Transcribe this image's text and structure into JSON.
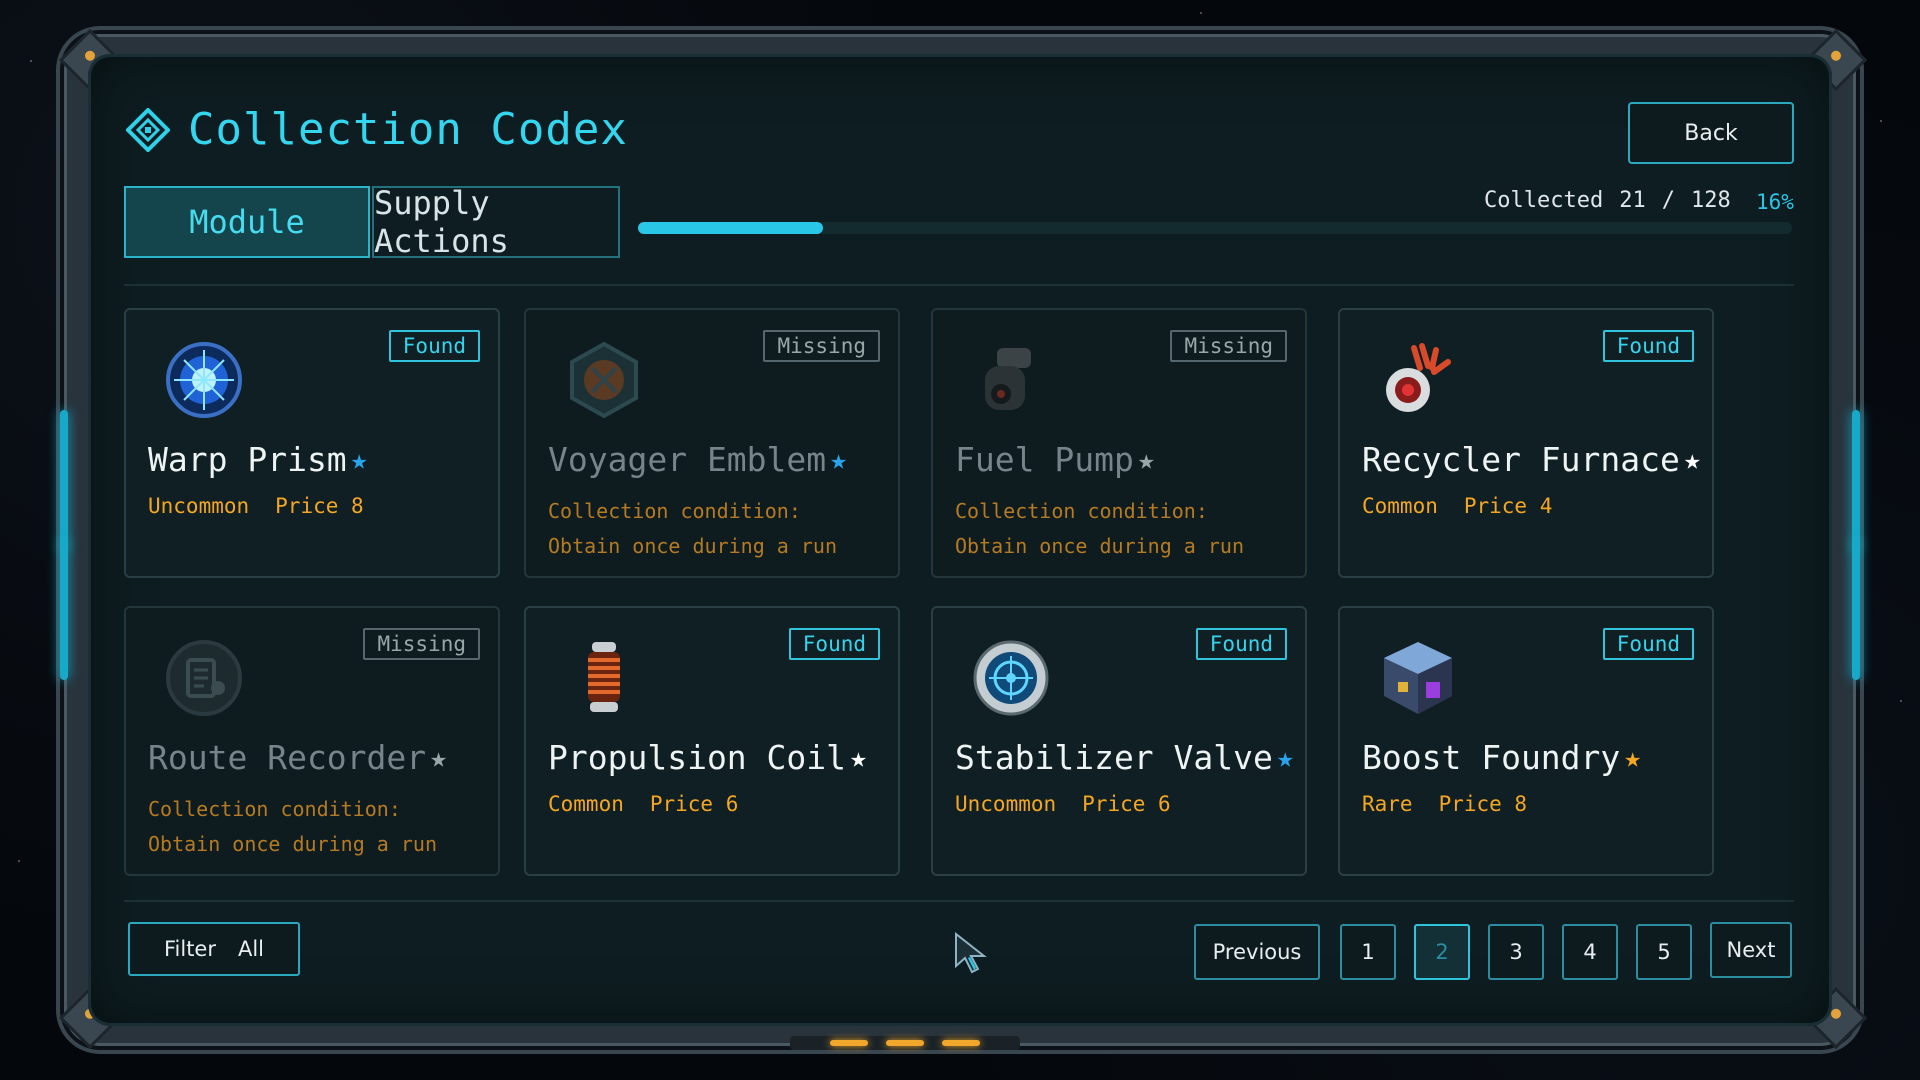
{
  "header": {
    "title": "Collection Codex",
    "title_icon": "diamond-target-icon",
    "back_label": "Back"
  },
  "tabs": [
    {
      "label": "Module",
      "active": true
    },
    {
      "label": "Supply Actions",
      "active": false
    }
  ],
  "progress": {
    "collected_label": "Collected",
    "collected": "21",
    "separator": "/",
    "total": "128",
    "percent_label": "16%",
    "fraction": 0.16
  },
  "cards": [
    {
      "name": "Warp Prism",
      "status": "Found",
      "rarity": "Uncommon",
      "price_label": "Price 8",
      "star_color": "#2aa3ee",
      "icon": "warp-prism-icon"
    },
    {
      "name": "Voyager Emblem",
      "status": "Missing",
      "cond1": "Collection condition:",
      "cond2": "Obtain once during a run",
      "star_color": "#2aa3ee",
      "icon": "voyager-emblem-icon"
    },
    {
      "name": "Fuel Pump",
      "status": "Missing",
      "cond1": "Collection condition:",
      "cond2": "Obtain once during a run",
      "star_color": "#9aa6aa",
      "icon": "fuel-pump-icon"
    },
    {
      "name": "Recycler Furnace",
      "status": "Found",
      "rarity": "Common",
      "price_label": "Price 4",
      "star_color": "#ffffff",
      "icon": "recycler-furnace-icon"
    },
    {
      "name": "Route Recorder",
      "status": "Missing",
      "cond1": "Collection condition:",
      "cond2": "Obtain once during a run",
      "star_color": "#9aa6aa",
      "icon": "route-recorder-icon"
    },
    {
      "name": "Propulsion Coil",
      "status": "Found",
      "rarity": "Common",
      "price_label": "Price 6",
      "star_color": "#ffffff",
      "icon": "propulsion-coil-icon"
    },
    {
      "name": "Stabilizer Valve",
      "status": "Found",
      "rarity": "Uncommon",
      "price_label": "Price 6",
      "star_color": "#2aa3ee",
      "icon": "stabilizer-valve-icon"
    },
    {
      "name": "Boost Foundry",
      "status": "Found",
      "rarity": "Rare",
      "price_label": "Price 8",
      "star_color": "#f5a623",
      "icon": "boost-foundry-icon"
    }
  ],
  "footer": {
    "filter_label": "Filter",
    "filter_value": "All",
    "previous_label": "Previous",
    "next_label": "Next",
    "pages": [
      "1",
      "2",
      "3",
      "4",
      "5"
    ],
    "current_page": "2"
  },
  "colors": {
    "accent": "#2fd1e8",
    "rarity_text": "#f5a623",
    "panel_bg": "#0e1d21"
  }
}
